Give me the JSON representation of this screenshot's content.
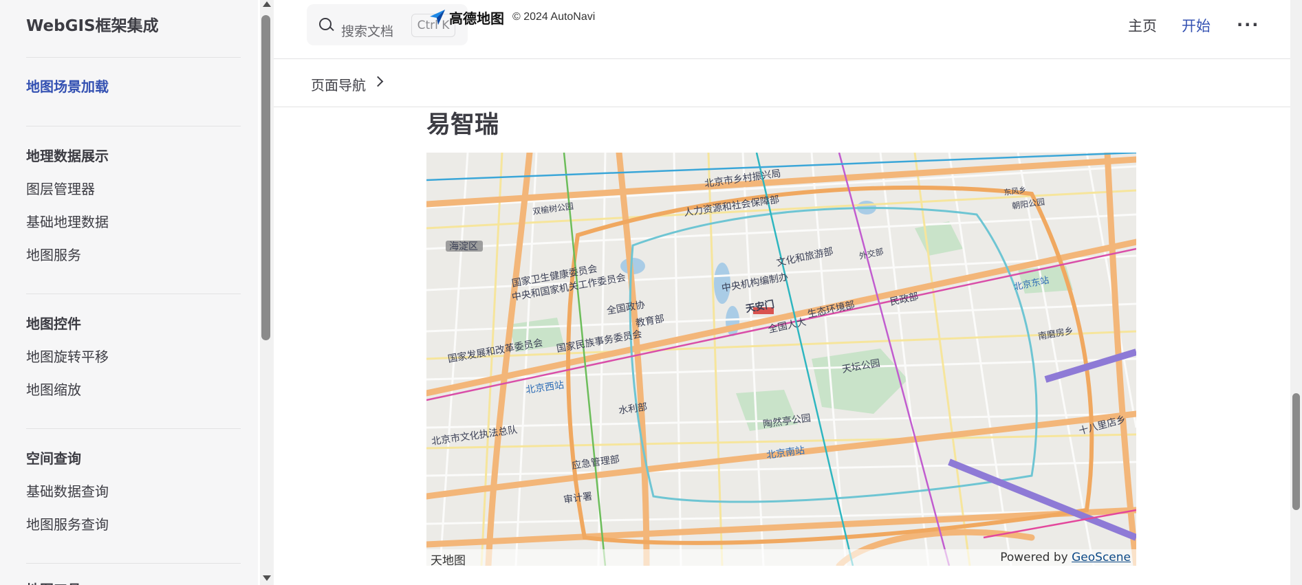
{
  "sidebar": {
    "site_title": "WebGIS框架集成",
    "active_link": "地图场景加载",
    "groups": [
      {
        "title": "地理数据展示",
        "items": [
          "图层管理器",
          "基础地理数据",
          "地图服务"
        ]
      },
      {
        "title": "地图控件",
        "items": [
          "地图旋转平移",
          "地图缩放"
        ]
      },
      {
        "title": "空间查询",
        "items": [
          "基础数据查询",
          "地图服务查询"
        ]
      },
      {
        "title": "地图工具"
      }
    ]
  },
  "topbar": {
    "search_placeholder": "搜索文档",
    "search_shortcut": "Ctrl K",
    "map_brand": "高德地图",
    "map_copyright": "© 2024 AutoNavi",
    "nav": {
      "home": "主页",
      "start": "开始",
      "more": "···"
    }
  },
  "pagenav": {
    "label": "页面导航"
  },
  "content": {
    "title": "易智瑞",
    "map": {
      "attribution_left": "天地图",
      "attribution_powered": "Powered by",
      "attribution_link": "GeoScene",
      "labels": [
        "北京市乡村振兴局",
        "人力资源和社会保障部",
        "双榆树公园",
        "朝阳公园",
        "东风乡",
        "国家卫生健康委员会",
        "中央和国家机关工作委员会",
        "文化和旅游部",
        "外交部",
        "中央机构编制办",
        "北京东站",
        "天安门",
        "生态环境部",
        "民政部",
        "全国政协",
        "全国人大",
        "教育部",
        "国家民族事务委员会",
        "国家发展和改革委员会",
        "南磨房乡",
        "天坛公园",
        "北京西站",
        "水利部",
        "北京市文化执法总队",
        "陶然亭公园",
        "北京南站",
        "应急管理部",
        "审计署",
        "十八里店乡",
        "海淀区"
      ]
    }
  }
}
